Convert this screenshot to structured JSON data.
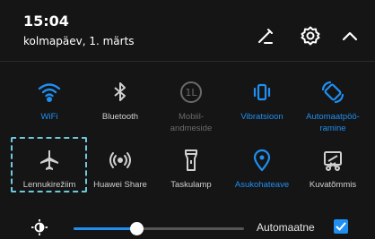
{
  "status": {
    "time": "15:04",
    "date": "kolmapäev, 1. märts"
  },
  "header_icons": [
    {
      "icon": "edit-icon"
    },
    {
      "icon": "gear-icon"
    },
    {
      "icon": "chevron-up-icon"
    }
  ],
  "tiles_row1": [
    {
      "label": "WiFi",
      "icon": "wifi-icon",
      "state": "on"
    },
    {
      "label": "Bluetooth",
      "icon": "bluetooth-icon",
      "state": "off"
    },
    {
      "label": "Mobiil-\nandmeside",
      "icon": "mobile-data-icon",
      "state": "disabled"
    },
    {
      "label": "Vibratsioon",
      "icon": "vibration-icon",
      "state": "on"
    },
    {
      "label": "Automaatpöö-\nramine",
      "icon": "auto-rotate-icon",
      "state": "on"
    }
  ],
  "tiles_row2": [
    {
      "label": "Lennukirežiim",
      "icon": "airplane-icon",
      "state": "off"
    },
    {
      "label": "Huawei Share",
      "icon": "huawei-share-icon",
      "state": "off"
    },
    {
      "label": "Taskulamp",
      "icon": "flashlight-icon",
      "state": "off"
    },
    {
      "label": "Asukohateave",
      "icon": "location-icon",
      "state": "on"
    },
    {
      "label": "Kuvatõmmis",
      "icon": "screenshot-icon",
      "state": "off"
    }
  ],
  "brightness": {
    "icon": "brightness-icon",
    "level": 0.37,
    "auto_label": "Automaatne",
    "auto_checked": true
  },
  "colors": {
    "accent": "#1f8ff2",
    "highlight": "#6fc9dd",
    "background": "#151515"
  }
}
